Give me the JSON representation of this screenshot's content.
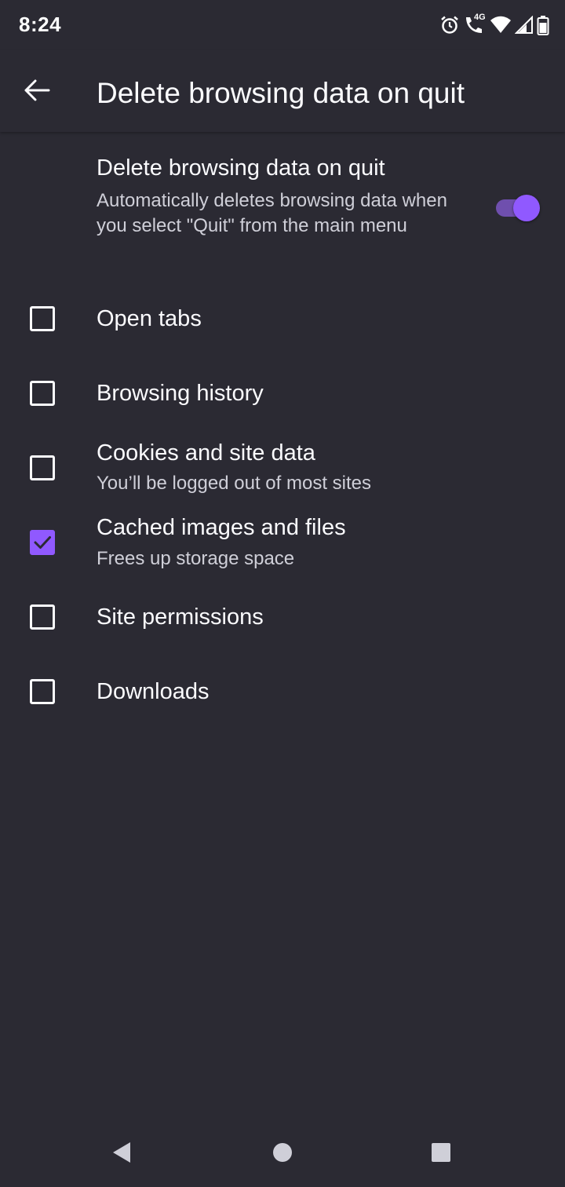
{
  "status_bar": {
    "time": "8:24",
    "network_label": "4G",
    "icons": [
      "alarm-icon",
      "wifi-calling-icon",
      "wifi-icon",
      "signal-icon",
      "battery-icon"
    ]
  },
  "app_bar": {
    "title": "Delete browsing data on quit",
    "back_icon": "arrow-left-icon"
  },
  "main_toggle": {
    "title": "Delete browsing data on quit",
    "summary": "Automatically deletes browsing data when you select \"Quit\" from the main menu",
    "enabled": true
  },
  "options": [
    {
      "title": "Open tabs",
      "summary": "",
      "checked": false
    },
    {
      "title": "Browsing history",
      "summary": "",
      "checked": false
    },
    {
      "title": "Cookies and site data",
      "summary": "You’ll be logged out of most sites",
      "checked": false
    },
    {
      "title": "Cached images and files",
      "summary": "Frees up storage space",
      "checked": true
    },
    {
      "title": "Site permissions",
      "summary": "",
      "checked": false
    },
    {
      "title": "Downloads",
      "summary": "",
      "checked": false
    }
  ],
  "nav_bar": {
    "icons": [
      "back-triangle-icon",
      "home-circle-icon",
      "recents-square-icon"
    ]
  },
  "colors": {
    "background": "#2b2a33",
    "accent": "#9059ff",
    "text_primary": "#fbfbfe",
    "text_secondary": "#cfcfd8"
  }
}
